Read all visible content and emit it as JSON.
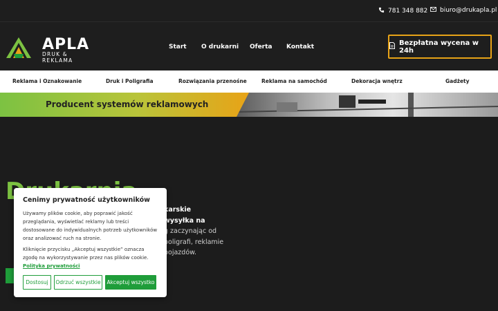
{
  "topbar": {
    "phone": "781 348 882",
    "email": "biuro@drukapla.pl"
  },
  "logo": {
    "name": "APLA",
    "tagline": "DRUK & REKLAMA"
  },
  "nav": [
    {
      "label": "Start"
    },
    {
      "label": "O drukarni"
    },
    {
      "label": "Oferta"
    },
    {
      "label": "Kontakt"
    }
  ],
  "quote_button": "Bezpłatna wycena w 24h",
  "categories": [
    {
      "label": "Reklama i Oznakowanie"
    },
    {
      "label": "Druk i Poligrafia"
    },
    {
      "label": "Rozwiązania przenośne"
    },
    {
      "label": "Reklama na samochód"
    },
    {
      "label": "Dekoracja wnętrz"
    },
    {
      "label": "Gadżety"
    }
  ],
  "hero": {
    "band_title": "Producent systemów reklamowych",
    "title": "Drukarnia",
    "text_lines": [
      "karskie",
      "wysyłka na",
      "g zaczynając od",
      "poligrafi, reklamie",
      "pojazdów."
    ]
  },
  "cookie": {
    "title": "Cenimy prywatność użytkowników",
    "text1": "Używamy plików cookie, aby poprawić jakość przeglądania, wyświetlać reklamy lub treści dostosowane do indywidualnych potrzeb użytkowników oraz analizować ruch na stronie.",
    "text2": "Kliknięcie przycisku „Akceptuj wszystkie” oznacza zgodę na wykorzystywanie przez nas plików cookie.",
    "policy_link": "Polityka prywatności",
    "buttons": {
      "customize": "Dostosuj",
      "reject": "Odrzuć wszystkie",
      "accept": "Akceptuj wszystko"
    }
  },
  "colors": {
    "accent_green": "#7cc242",
    "button_green": "#1f9d3a",
    "accent_orange": "#e8a317",
    "dark_bg": "#1c1c1c"
  }
}
